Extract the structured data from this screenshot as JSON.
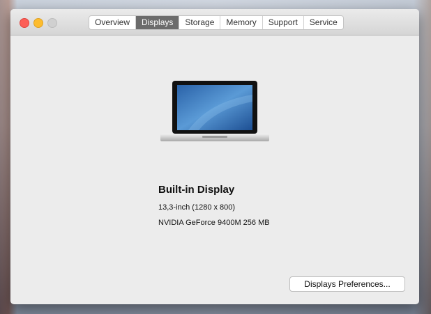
{
  "tabs": [
    {
      "label": "Overview"
    },
    {
      "label": "Displays",
      "selected": true
    },
    {
      "label": "Storage"
    },
    {
      "label": "Memory"
    },
    {
      "label": "Support"
    },
    {
      "label": "Service"
    }
  ],
  "display": {
    "name": "Built-in Display",
    "size": "13,3-inch (1280 x 800)",
    "gpu": "NVIDIA GeForce 9400M 256 MB"
  },
  "preferences_button": "Displays Preferences..."
}
